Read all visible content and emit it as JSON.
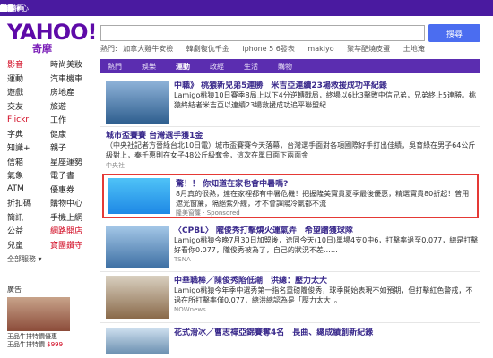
{
  "topbar": {
    "items": [
      "首頁",
      "信箱",
      "新聞",
      "股市",
      "氣象",
      "運動",
      "影音",
      "娛樂",
      "Flickr",
      "購物中心",
      "商城",
      "拍賣"
    ],
    "more": "更多"
  },
  "header": {
    "logo_text": "YAHOO!",
    "logo_sub": "奇摩",
    "search_placeholder": "",
    "search_button": "搜尋",
    "hot_label": "熱門:",
    "hot_items": [
      "加拿大雞牛安檢",
      "韓劇復仇千金",
      "iphone 5 6發表",
      "makiyo",
      "聚萃酷燒皮蛋",
      "土地淹"
    ]
  },
  "sidebar": {
    "rows": [
      [
        "影音",
        "時尚美妝"
      ],
      [
        "運動",
        "汽車機車"
      ],
      [
        "遊戲",
        "房地產"
      ],
      [
        "交友",
        "旅遊"
      ],
      [
        "Flickr",
        "工作"
      ],
      [
        "字典",
        "健康"
      ],
      [
        "知識+",
        "親子"
      ],
      [
        "信箱",
        "星座運勢"
      ],
      [
        "氣象",
        "電子書"
      ],
      [
        "ATM",
        "優惠券"
      ],
      [
        "折扣碼",
        "購物中心"
      ],
      [
        "簡訊",
        "手機上網"
      ],
      [
        "公益",
        "網路開店"
      ],
      [
        "兒童",
        "寶團鑽守"
      ]
    ],
    "all_label": "全部服務",
    "sub_heading": "廣告",
    "promo_text": "王品牛排特價優惠",
    "promo_text2": "王品牛排特價",
    "promo_price": "$999"
  },
  "tabs": [
    "熱門",
    "娛樂",
    "運動",
    "政經",
    "生活",
    "購物"
  ],
  "news": [
    {
      "title": "中職》 桃猿新兒弟5連勝　米吉亞連續23場救援成功平紀錄",
      "body": "Lamigo桃猿10日賽季8局上以下4分逆轉戰局，終場以6比3擊敗中信兄弟，兄弟終止5連勝。桃猿終結者米吉亞以連續23場救援成功追平聯盟紀",
      "source": ""
    },
    {
      "title": "城市盃賽賽 台灣選手獲1金",
      "body": "（中央社記者方晉綠台北10日電）城市盃賽賽今天落幕，台灣選手面對各項國際好手打出佳績，吳育綠在男子64公斤級對上，秦千惠則在女子48公斤級奪金，這次在單日面下兩面金",
      "source": "中央社"
    },
    {
      "title": "〈CPBL〉 隴俊秀打擊燒火運氣弄　希望蹭獲球隊",
      "body": "Lamigo桃猿今晚7月30日加盟後，途同今天(10日)單場4支0中6，打擊率退至0.077，總是打擊好看你0.077，隴俊秀被為了，自己的狀況不差……",
      "source": "TSNA"
    },
    {
      "title": "中華職棒／陳俊秀陷低潮　洪總：壓力太大",
      "body": "Lamigo桃猿今年季中選秀第一指名重磅隴俊秀，球季開始表現不如預期，但打擊紅色警戒，不過在所打擊率僅0.077，總洪總認為是「壓力太大」。",
      "source": "NOWnews"
    },
    {
      "title": "花式滑冰／曹志禕亞錦賽奪4名　長曲、總成績創新紀錄",
      "body": "",
      "source": ""
    }
  ],
  "ad": {
    "title": "驚！！ 你知道在家也會中暑嗎?",
    "body": "8月真的很熱，連在家裡都有中暑危機！把握隆美寶貴夏季最後優惠，精選寶貴80折起！曾用遮光窗簾，隔絕紫外線，才不會譯陽冷氣都不流",
    "sponsor": "隆美窗簾",
    "sponsored_label": "Sponsored"
  }
}
